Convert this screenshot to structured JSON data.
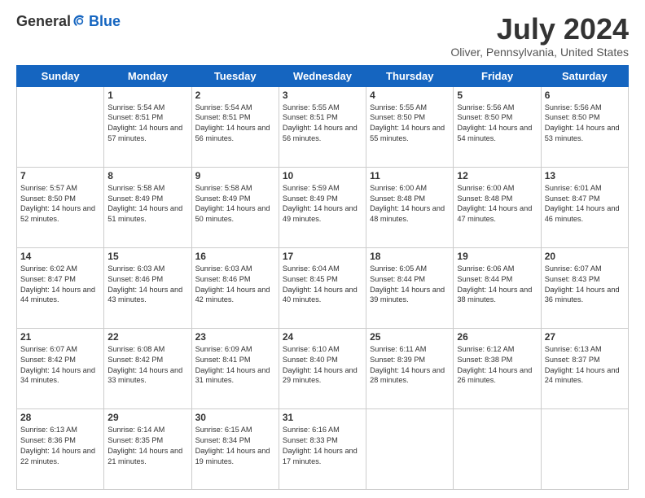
{
  "logo": {
    "general": "General",
    "blue": "Blue"
  },
  "header": {
    "title": "July 2024",
    "subtitle": "Oliver, Pennsylvania, United States"
  },
  "weekdays": [
    "Sunday",
    "Monday",
    "Tuesday",
    "Wednesday",
    "Thursday",
    "Friday",
    "Saturday"
  ],
  "weeks": [
    [
      {
        "day": "",
        "sunrise": "",
        "sunset": "",
        "daylight": ""
      },
      {
        "day": "1",
        "sunrise": "Sunrise: 5:54 AM",
        "sunset": "Sunset: 8:51 PM",
        "daylight": "Daylight: 14 hours and 57 minutes."
      },
      {
        "day": "2",
        "sunrise": "Sunrise: 5:54 AM",
        "sunset": "Sunset: 8:51 PM",
        "daylight": "Daylight: 14 hours and 56 minutes."
      },
      {
        "day": "3",
        "sunrise": "Sunrise: 5:55 AM",
        "sunset": "Sunset: 8:51 PM",
        "daylight": "Daylight: 14 hours and 56 minutes."
      },
      {
        "day": "4",
        "sunrise": "Sunrise: 5:55 AM",
        "sunset": "Sunset: 8:50 PM",
        "daylight": "Daylight: 14 hours and 55 minutes."
      },
      {
        "day": "5",
        "sunrise": "Sunrise: 5:56 AM",
        "sunset": "Sunset: 8:50 PM",
        "daylight": "Daylight: 14 hours and 54 minutes."
      },
      {
        "day": "6",
        "sunrise": "Sunrise: 5:56 AM",
        "sunset": "Sunset: 8:50 PM",
        "daylight": "Daylight: 14 hours and 53 minutes."
      }
    ],
    [
      {
        "day": "7",
        "sunrise": "Sunrise: 5:57 AM",
        "sunset": "Sunset: 8:50 PM",
        "daylight": "Daylight: 14 hours and 52 minutes."
      },
      {
        "day": "8",
        "sunrise": "Sunrise: 5:58 AM",
        "sunset": "Sunset: 8:49 PM",
        "daylight": "Daylight: 14 hours and 51 minutes."
      },
      {
        "day": "9",
        "sunrise": "Sunrise: 5:58 AM",
        "sunset": "Sunset: 8:49 PM",
        "daylight": "Daylight: 14 hours and 50 minutes."
      },
      {
        "day": "10",
        "sunrise": "Sunrise: 5:59 AM",
        "sunset": "Sunset: 8:49 PM",
        "daylight": "Daylight: 14 hours and 49 minutes."
      },
      {
        "day": "11",
        "sunrise": "Sunrise: 6:00 AM",
        "sunset": "Sunset: 8:48 PM",
        "daylight": "Daylight: 14 hours and 48 minutes."
      },
      {
        "day": "12",
        "sunrise": "Sunrise: 6:00 AM",
        "sunset": "Sunset: 8:48 PM",
        "daylight": "Daylight: 14 hours and 47 minutes."
      },
      {
        "day": "13",
        "sunrise": "Sunrise: 6:01 AM",
        "sunset": "Sunset: 8:47 PM",
        "daylight": "Daylight: 14 hours and 46 minutes."
      }
    ],
    [
      {
        "day": "14",
        "sunrise": "Sunrise: 6:02 AM",
        "sunset": "Sunset: 8:47 PM",
        "daylight": "Daylight: 14 hours and 44 minutes."
      },
      {
        "day": "15",
        "sunrise": "Sunrise: 6:03 AM",
        "sunset": "Sunset: 8:46 PM",
        "daylight": "Daylight: 14 hours and 43 minutes."
      },
      {
        "day": "16",
        "sunrise": "Sunrise: 6:03 AM",
        "sunset": "Sunset: 8:46 PM",
        "daylight": "Daylight: 14 hours and 42 minutes."
      },
      {
        "day": "17",
        "sunrise": "Sunrise: 6:04 AM",
        "sunset": "Sunset: 8:45 PM",
        "daylight": "Daylight: 14 hours and 40 minutes."
      },
      {
        "day": "18",
        "sunrise": "Sunrise: 6:05 AM",
        "sunset": "Sunset: 8:44 PM",
        "daylight": "Daylight: 14 hours and 39 minutes."
      },
      {
        "day": "19",
        "sunrise": "Sunrise: 6:06 AM",
        "sunset": "Sunset: 8:44 PM",
        "daylight": "Daylight: 14 hours and 38 minutes."
      },
      {
        "day": "20",
        "sunrise": "Sunrise: 6:07 AM",
        "sunset": "Sunset: 8:43 PM",
        "daylight": "Daylight: 14 hours and 36 minutes."
      }
    ],
    [
      {
        "day": "21",
        "sunrise": "Sunrise: 6:07 AM",
        "sunset": "Sunset: 8:42 PM",
        "daylight": "Daylight: 14 hours and 34 minutes."
      },
      {
        "day": "22",
        "sunrise": "Sunrise: 6:08 AM",
        "sunset": "Sunset: 8:42 PM",
        "daylight": "Daylight: 14 hours and 33 minutes."
      },
      {
        "day": "23",
        "sunrise": "Sunrise: 6:09 AM",
        "sunset": "Sunset: 8:41 PM",
        "daylight": "Daylight: 14 hours and 31 minutes."
      },
      {
        "day": "24",
        "sunrise": "Sunrise: 6:10 AM",
        "sunset": "Sunset: 8:40 PM",
        "daylight": "Daylight: 14 hours and 29 minutes."
      },
      {
        "day": "25",
        "sunrise": "Sunrise: 6:11 AM",
        "sunset": "Sunset: 8:39 PM",
        "daylight": "Daylight: 14 hours and 28 minutes."
      },
      {
        "day": "26",
        "sunrise": "Sunrise: 6:12 AM",
        "sunset": "Sunset: 8:38 PM",
        "daylight": "Daylight: 14 hours and 26 minutes."
      },
      {
        "day": "27",
        "sunrise": "Sunrise: 6:13 AM",
        "sunset": "Sunset: 8:37 PM",
        "daylight": "Daylight: 14 hours and 24 minutes."
      }
    ],
    [
      {
        "day": "28",
        "sunrise": "Sunrise: 6:13 AM",
        "sunset": "Sunset: 8:36 PM",
        "daylight": "Daylight: 14 hours and 22 minutes."
      },
      {
        "day": "29",
        "sunrise": "Sunrise: 6:14 AM",
        "sunset": "Sunset: 8:35 PM",
        "daylight": "Daylight: 14 hours and 21 minutes."
      },
      {
        "day": "30",
        "sunrise": "Sunrise: 6:15 AM",
        "sunset": "Sunset: 8:34 PM",
        "daylight": "Daylight: 14 hours and 19 minutes."
      },
      {
        "day": "31",
        "sunrise": "Sunrise: 6:16 AM",
        "sunset": "Sunset: 8:33 PM",
        "daylight": "Daylight: 14 hours and 17 minutes."
      },
      {
        "day": "",
        "sunrise": "",
        "sunset": "",
        "daylight": ""
      },
      {
        "day": "",
        "sunrise": "",
        "sunset": "",
        "daylight": ""
      },
      {
        "day": "",
        "sunrise": "",
        "sunset": "",
        "daylight": ""
      }
    ]
  ]
}
